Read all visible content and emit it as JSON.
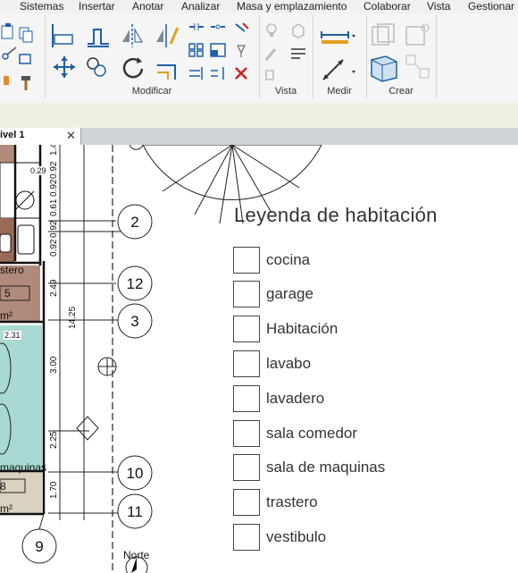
{
  "menu": {
    "items": [
      "Sistemas",
      "Insertar",
      "Anotar",
      "Analizar",
      "Masa y emplazamiento",
      "Colaborar",
      "Vista",
      "Gestionar"
    ]
  },
  "ribbon": {
    "panels": {
      "modificar": "Modificar",
      "vista": "Vista",
      "medir": "Medir",
      "crear": "Crear"
    }
  },
  "tab": {
    "label": "ivel 1",
    "close": "✕"
  },
  "legend": {
    "title": "Leyenda de habitación",
    "items": [
      "cocina",
      "garage",
      "Habitación",
      "lavabo",
      "lavadero",
      "sala comedor",
      "sala de maquinas",
      "trastero",
      "vestibulo"
    ]
  },
  "drawing": {
    "grid_bubbles": [
      "2",
      "12",
      "3",
      "10",
      "11",
      "9"
    ],
    "dimensions": [
      "0.29",
      "1.4",
      "0.92",
      "0.92",
      "0.61",
      "0.92",
      "0.92",
      "2.49",
      "14.25",
      "3.00",
      "2.25",
      "1.70",
      "2.31"
    ],
    "room_labels": [
      "stero",
      "5",
      "m²",
      "maquinas",
      "8",
      "m²"
    ],
    "north_label": "Norte"
  },
  "colors": {
    "room_brown": "#b08a7a",
    "room_dark_brown": "#9a6a58",
    "room_teal": "#a8d9d2",
    "room_beige": "#d9d2c0",
    "ribbon_bg": "#f5f5f5",
    "strip_bg": "#eef2e0"
  }
}
